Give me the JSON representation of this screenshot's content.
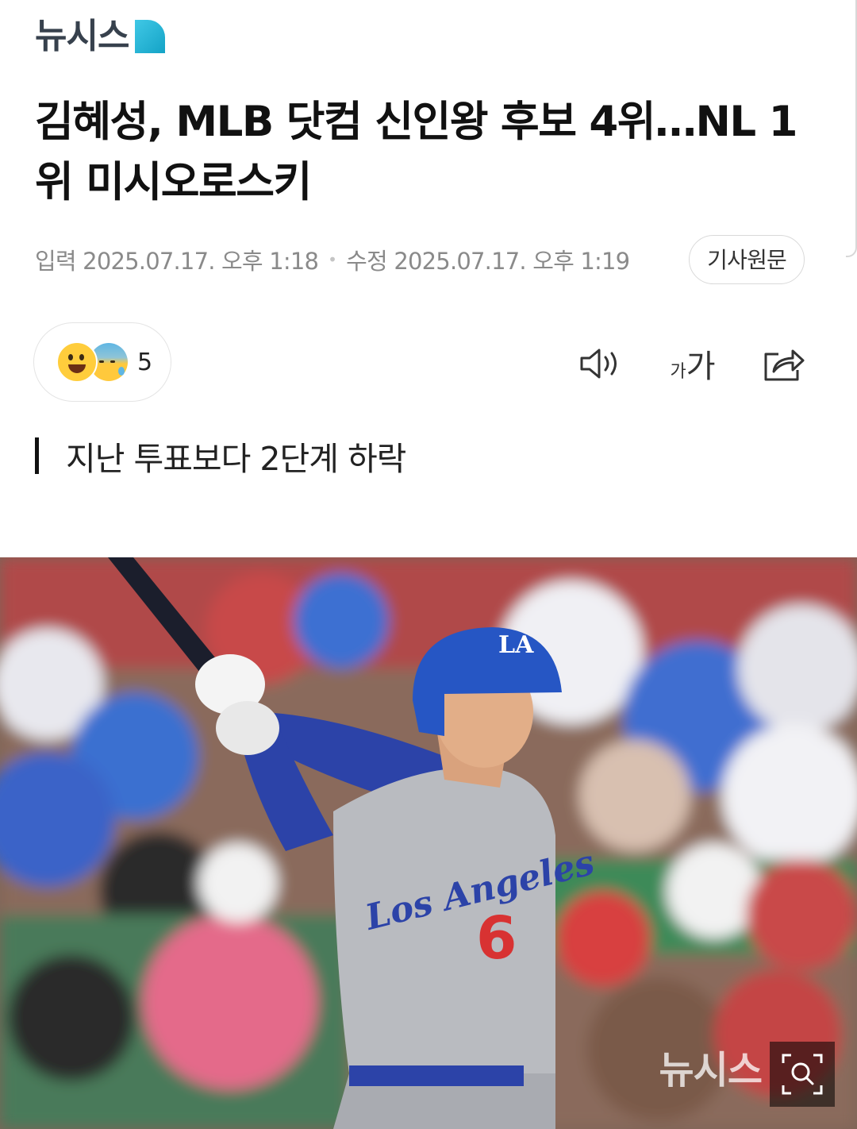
{
  "brand": {
    "logo_text": "뉴시스"
  },
  "article": {
    "headline": "김혜성, MLB 닷컴 신인왕 후보 4위…NL 1위 미시오로스키",
    "published": "입력 2025.07.17. 오후 1:18",
    "modified": "수정 2025.07.17. 오후 1:19",
    "original_button": "기사원문",
    "subtitle": "지난 투표보다 2단계 하락"
  },
  "reactions": {
    "count": "5",
    "icons": [
      "grinning-face-icon",
      "sad-sweat-face-icon"
    ]
  },
  "toolbar": {
    "font_small": "가",
    "font_large": "가",
    "icons": [
      "speaker-icon",
      "font-size-icon",
      "share-icon"
    ]
  },
  "photo": {
    "description_icon": "zoom-icon",
    "watermark": "뉴시스",
    "jersey_number": "6",
    "jersey_text": "Los Angeles",
    "cap_logo": "LA"
  },
  "colors": {
    "logo_dark": "#37414d",
    "logo_accent": "#1fb3d6",
    "text": "#111111",
    "meta": "#8a8a8a"
  }
}
